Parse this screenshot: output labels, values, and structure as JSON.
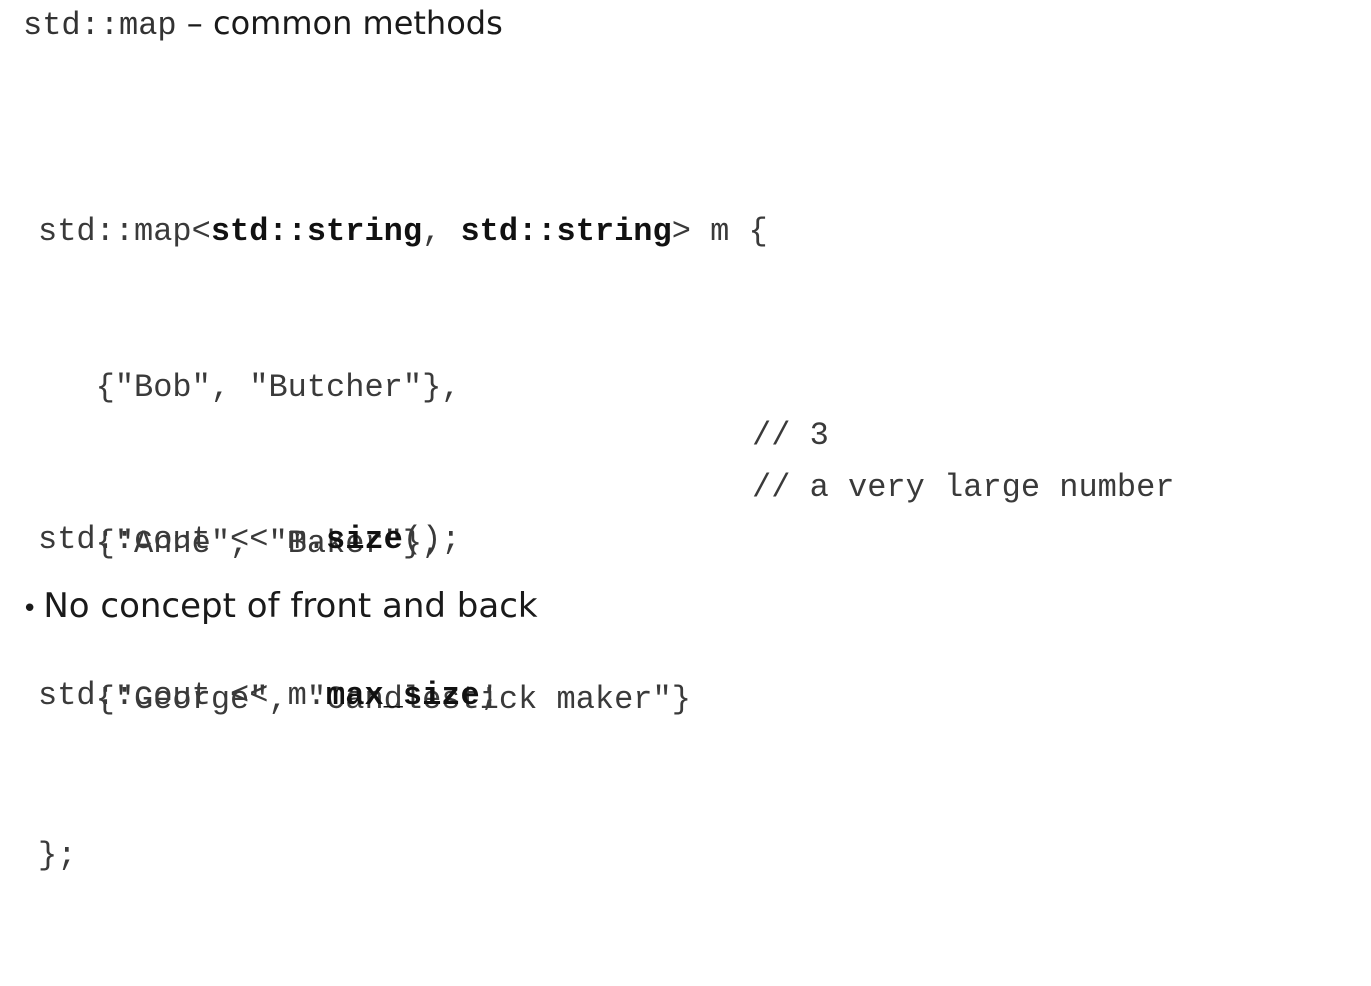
{
  "title": {
    "mono_part": "std::map",
    "sans_part": " – common methods"
  },
  "code_block_1": {
    "line1_a": "std::map<",
    "line1_b": "std::string",
    "line1_c": ", ",
    "line1_d": "std::string",
    "line1_e": "> m {",
    "line2": "   {\"Bob\", \"Butcher\"},",
    "line3": "   {\"Anne\", \"Baker\"},",
    "line4": "   {\"George\", \"Candlestick maker\"}",
    "line5": "};"
  },
  "code_block_2": {
    "line1_a": "std::cout << m.",
    "line1_b": "size",
    "line1_c": "();",
    "line1_comment": "// 3",
    "line2_a": "std::cout << m.",
    "line2_b": "max_size",
    "line2_c": ";",
    "line2_comment": "// a very large number"
  },
  "bullets": [
    {
      "marker": "•",
      "text": "No concept of front and back"
    }
  ]
}
